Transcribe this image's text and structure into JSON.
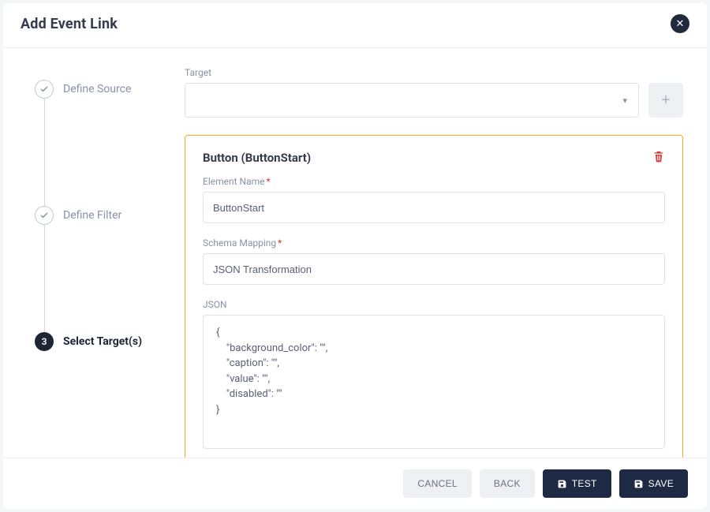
{
  "modal": {
    "title": "Add Event Link"
  },
  "stepper": {
    "steps": [
      {
        "label": "Define Source",
        "status": "done"
      },
      {
        "label": "Define Filter",
        "status": "done"
      },
      {
        "label": "Select Target(s)",
        "status": "active",
        "number": "3"
      }
    ]
  },
  "target": {
    "label": "Target"
  },
  "card": {
    "title": "Button (ButtonStart)",
    "element_name_label": "Element Name",
    "element_name_value": "ButtonStart",
    "schema_label": "Schema Mapping",
    "schema_value": "JSON Transformation",
    "json_label": "JSON",
    "json_value": "{\n    \"background_color\": \"\",\n    \"caption\": \"\",\n    \"value\": \"\",\n    \"disabled\": \"\"\n}"
  },
  "footer": {
    "cancel": "CANCEL",
    "back": "BACK",
    "test": "TEST",
    "save": "SAVE"
  }
}
